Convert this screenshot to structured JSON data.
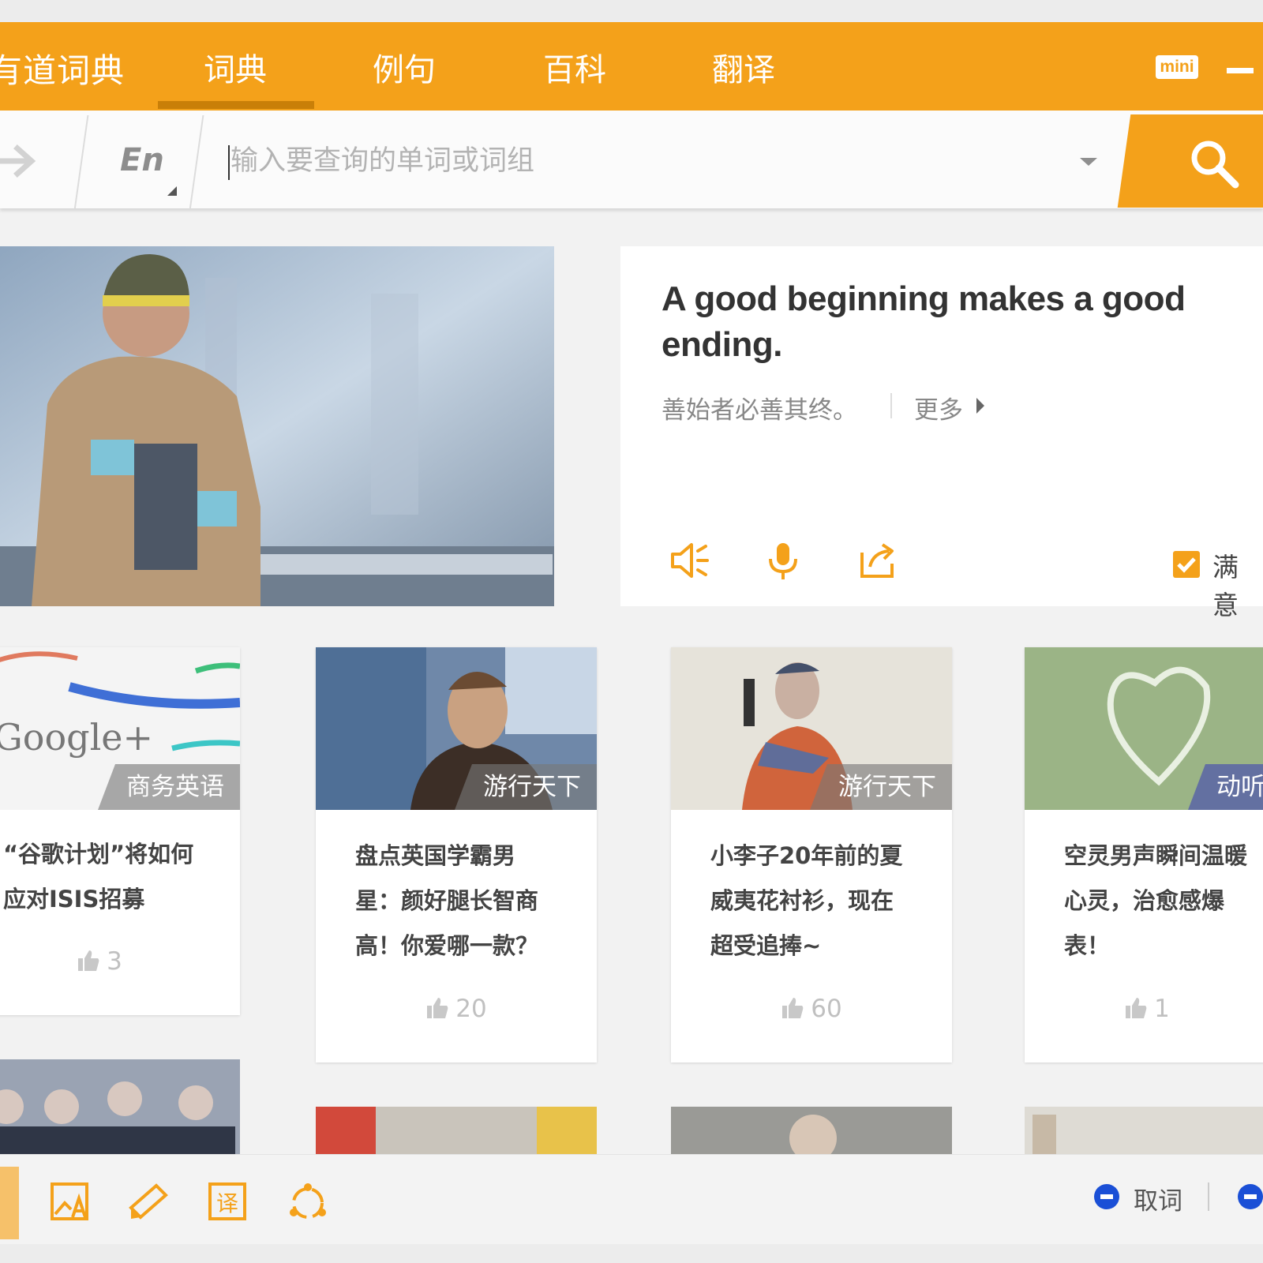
{
  "app": {
    "brand": "有道词典",
    "mini_label": "mini"
  },
  "nav": {
    "tabs": [
      "词典",
      "例句",
      "百科",
      "翻译"
    ],
    "active": 0
  },
  "search": {
    "lang": "En",
    "placeholder": "输入要查询的单词或词组"
  },
  "daily": {
    "quote_en": "A good beginning makes a good ending.",
    "quote_cn": "善始者必善其终。",
    "more": "更多",
    "satisfied": "满意"
  },
  "cards": [
    {
      "tag": "商务英语",
      "title": "“谷歌计划”将如何应对ISIS招募",
      "likes": "3"
    },
    {
      "tag": "游行天下",
      "title": "盘点英国学霸男星：颜好腿长智商高！你爱哪一款？",
      "likes": "20"
    },
    {
      "tag": "游行天下",
      "title": "小李子20年前的夏威夷花衬衫，现在超受追捧~",
      "likes": "60"
    },
    {
      "tag": "动听英",
      "title": "空灵男声瞬间温暖心灵，治愈感爆表！",
      "likes": "1"
    }
  ],
  "bottom": {
    "status": "取词"
  },
  "colors": {
    "accent": "#f4a11a",
    "accent_dark": "#c97f08",
    "status_blue": "#1a4fd6"
  }
}
